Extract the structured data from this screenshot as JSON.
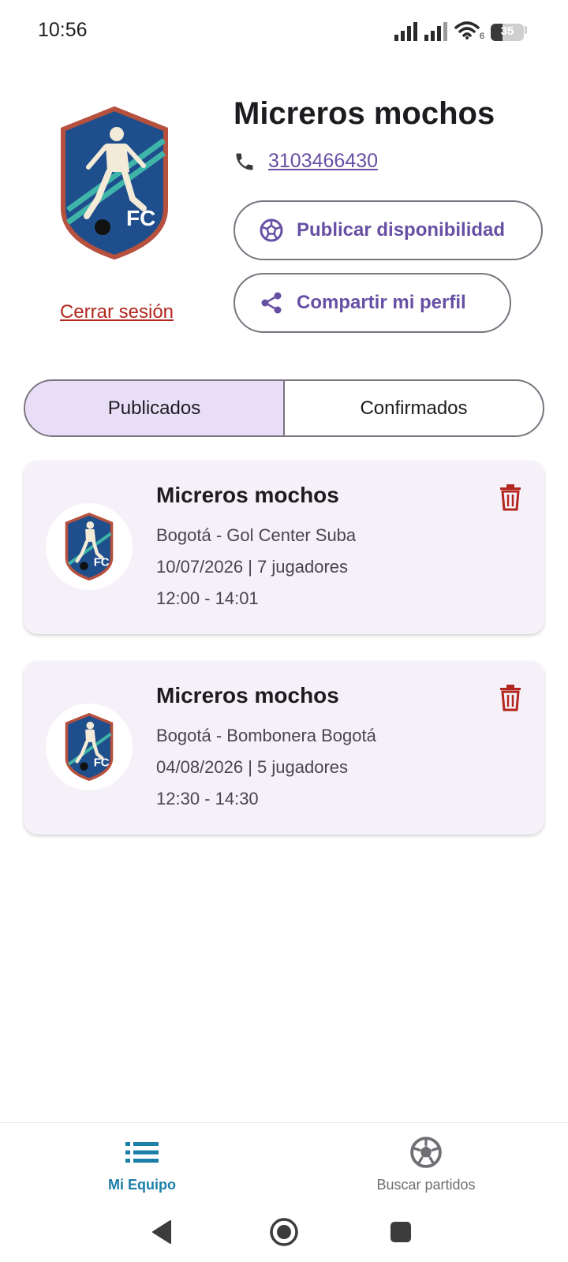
{
  "status_bar": {
    "time": "10:56",
    "battery_level": "35",
    "network_label": "6"
  },
  "profile": {
    "team_name": "Micreros mochos",
    "phone": "3103466430",
    "logout_label": "Cerrar sesión",
    "publish_label": "Publicar disponibilidad",
    "share_label": "Compartir mi perfil",
    "crest_text": "FC"
  },
  "tabs": [
    {
      "label": "Publicados",
      "selected": true
    },
    {
      "label": "Confirmados",
      "selected": false
    }
  ],
  "matches": [
    {
      "team": "Micreros mochos",
      "location": "Bogotá - Gol Center Suba",
      "date_players": "10/07/2026 | 7 jugadores",
      "time": "12:00 - 14:01"
    },
    {
      "team": "Micreros mochos",
      "location": "Bogotá - Bombonera Bogotá",
      "date_players": "04/08/2026 | 5 jugadores",
      "time": "12:30 - 14:30"
    }
  ],
  "bottom_nav": {
    "home_label": "Mi Equipo",
    "search_label": "Buscar partidos"
  },
  "colors": {
    "accent_purple": "#6750a4",
    "danger_red": "#b3261e",
    "nav_active": "#1b7fa8",
    "tab_selected_bg": "#e8def8",
    "card_bg": "#f6f1f8",
    "crest_blue": "#1f4e8c",
    "crest_border": "#b5513e"
  },
  "icons": {
    "phone": "phone-icon",
    "publish": "soccer-ball-icon",
    "share": "share-icon",
    "delete": "trash-icon",
    "nav_home": "list-icon",
    "nav_search": "soccer-ball-icon"
  }
}
